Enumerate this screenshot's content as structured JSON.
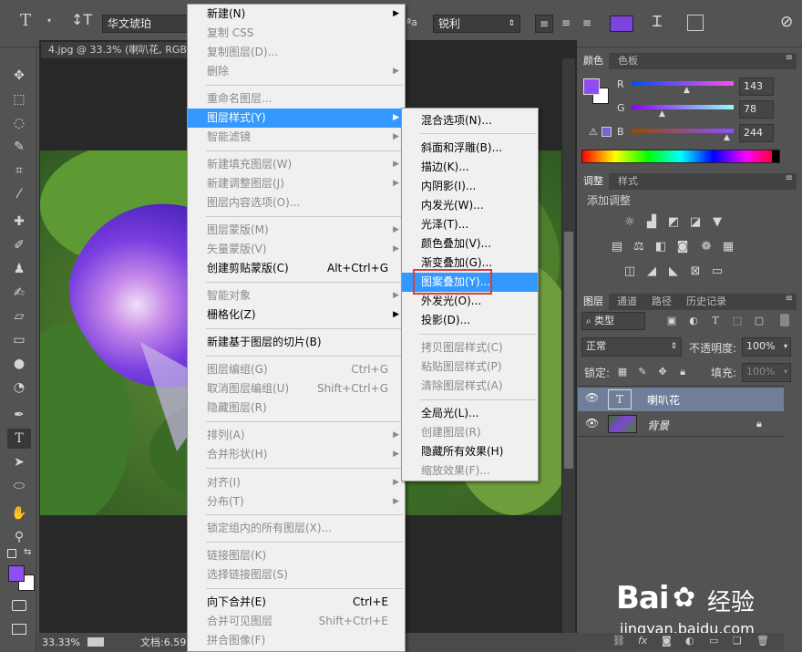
{
  "options_bar": {
    "font_family": "华文琥珀",
    "antialias": "锐利",
    "text_color": "#7b44e0"
  },
  "document": {
    "tab_title": "4.jpg @ 33.3% (喇叭花, RGB",
    "zoom": "33.33%",
    "doc_info": "文档:6.59"
  },
  "layer_menu": {
    "items": [
      {
        "label": "新建(N)",
        "shortcut": "",
        "submenu": true,
        "disabled": false
      },
      {
        "label": "复制 CSS",
        "shortcut": "",
        "submenu": false,
        "disabled": true
      },
      {
        "label": "复制图层(D)...",
        "shortcut": "",
        "submenu": false,
        "disabled": true
      },
      {
        "label": "删除",
        "shortcut": "",
        "submenu": true,
        "disabled": true
      },
      {
        "label": "重命名图层...",
        "shortcut": "",
        "submenu": false,
        "disabled": true
      },
      {
        "label": "图层样式(Y)",
        "shortcut": "",
        "submenu": true,
        "disabled": false,
        "highlighted": true
      },
      {
        "label": "智能滤镜",
        "shortcut": "",
        "submenu": true,
        "disabled": true
      },
      {
        "label": "新建填充图层(W)",
        "shortcut": "",
        "submenu": true,
        "disabled": true
      },
      {
        "label": "新建调整图层(J)",
        "shortcut": "",
        "submenu": true,
        "disabled": true
      },
      {
        "label": "图层内容选项(O)...",
        "shortcut": "",
        "submenu": false,
        "disabled": true
      },
      {
        "label": "图层蒙版(M)",
        "shortcut": "",
        "submenu": true,
        "disabled": true
      },
      {
        "label": "矢量蒙版(V)",
        "shortcut": "",
        "submenu": true,
        "disabled": true
      },
      {
        "label": "创建剪贴蒙版(C)",
        "shortcut": "Alt+Ctrl+G",
        "submenu": false,
        "disabled": false
      },
      {
        "label": "智能对象",
        "shortcut": "",
        "submenu": true,
        "disabled": true
      },
      {
        "label": "栅格化(Z)",
        "shortcut": "",
        "submenu": true,
        "disabled": false
      },
      {
        "label": "新建基于图层的切片(B)",
        "shortcut": "",
        "submenu": false,
        "disabled": false
      },
      {
        "label": "图层编组(G)",
        "shortcut": "Ctrl+G",
        "submenu": false,
        "disabled": true
      },
      {
        "label": "取消图层编组(U)",
        "shortcut": "Shift+Ctrl+G",
        "submenu": false,
        "disabled": true
      },
      {
        "label": "隐藏图层(R)",
        "shortcut": "",
        "submenu": false,
        "disabled": true
      },
      {
        "label": "排列(A)",
        "shortcut": "",
        "submenu": true,
        "disabled": true
      },
      {
        "label": "合并形状(H)",
        "shortcut": "",
        "submenu": true,
        "disabled": true
      },
      {
        "label": "对齐(I)",
        "shortcut": "",
        "submenu": true,
        "disabled": true
      },
      {
        "label": "分布(T)",
        "shortcut": "",
        "submenu": true,
        "disabled": true
      },
      {
        "label": "锁定组内的所有图层(X)...",
        "shortcut": "",
        "submenu": false,
        "disabled": true
      },
      {
        "label": "链接图层(K)",
        "shortcut": "",
        "submenu": false,
        "disabled": true
      },
      {
        "label": "选择链接图层(S)",
        "shortcut": "",
        "submenu": false,
        "disabled": true
      },
      {
        "label": "向下合并(E)",
        "shortcut": "Ctrl+E",
        "submenu": false,
        "disabled": false
      },
      {
        "label": "合并可见图层",
        "shortcut": "Shift+Ctrl+E",
        "submenu": false,
        "disabled": true
      },
      {
        "label": "拼合图像(F)",
        "shortcut": "",
        "submenu": false,
        "disabled": true
      }
    ]
  },
  "style_submenu": {
    "items": [
      {
        "label": "混合选项(N)...",
        "disabled": false
      },
      {
        "label": "斜面和浮雕(B)...",
        "disabled": false
      },
      {
        "label": "描边(K)...",
        "disabled": false
      },
      {
        "label": "内阴影(I)...",
        "disabled": false
      },
      {
        "label": "内发光(W)...",
        "disabled": false
      },
      {
        "label": "光泽(T)...",
        "disabled": false
      },
      {
        "label": "颜色叠加(V)...",
        "disabled": false
      },
      {
        "label": "渐变叠加(G)...",
        "disabled": false
      },
      {
        "label": "图案叠加(Y)...",
        "disabled": false,
        "highlighted": true
      },
      {
        "label": "外发光(O)...",
        "disabled": false
      },
      {
        "label": "投影(D)...",
        "disabled": false
      },
      {
        "label": "拷贝图层样式(C)",
        "disabled": true
      },
      {
        "label": "粘贴图层样式(P)",
        "disabled": true
      },
      {
        "label": "清除图层样式(A)",
        "disabled": true
      },
      {
        "label": "全局光(L)...",
        "disabled": false
      },
      {
        "label": "创建图层(R)",
        "disabled": true
      },
      {
        "label": "隐藏所有效果(H)",
        "disabled": false
      },
      {
        "label": "缩放效果(F)...",
        "disabled": true
      }
    ]
  },
  "color_panel": {
    "tabs": [
      "颜色",
      "色板"
    ],
    "r_label": "R",
    "g_label": "G",
    "b_label": "B",
    "r": 143,
    "g": 78,
    "b": 244,
    "r_value": "143",
    "g_value": "78",
    "b_value": "244",
    "foreground": "#8f4ef4",
    "background": "#ffffff"
  },
  "adjust_panel": {
    "tabs": [
      "调整",
      "样式"
    ],
    "hint": "添加调整"
  },
  "layers_panel": {
    "tabs": [
      "图层",
      "通道",
      "路径",
      "历史记录"
    ],
    "filter": "类型",
    "blend_mode": "正常",
    "opacity_label": "不透明度:",
    "opacity": "100%",
    "lock_label": "锁定:",
    "fill_label": "填充:",
    "fill": "100%",
    "layers": [
      {
        "name": "喇叭花",
        "type": "text",
        "selected": true
      },
      {
        "name": "背景",
        "type": "image",
        "selected": false,
        "locked": true
      }
    ]
  },
  "watermark": {
    "brand": "Bai",
    "brand_suffix": "经验",
    "url": "jingyan.baidu.com"
  }
}
